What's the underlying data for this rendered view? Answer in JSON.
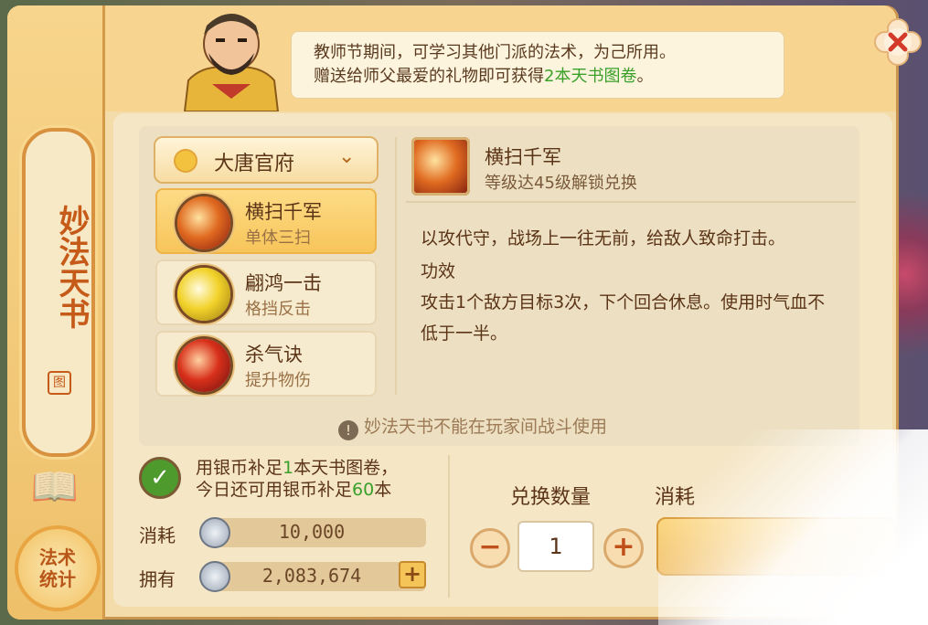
{
  "hint": {
    "line1": "教师节期间，可学习其他门派的法术，为己所用。",
    "line2_pre": "赠送给师父最爱的礼物即可获得",
    "line2_highlight": "2本天书图卷",
    "line2_post": "。"
  },
  "sidebar": {
    "title": "妙法天书",
    "seal": "图",
    "stats_button": "法术统计"
  },
  "sect_dropdown": {
    "selected": "大唐官府"
  },
  "skills": [
    {
      "name": "横扫千军",
      "desc": "单体三扫",
      "active": true
    },
    {
      "name": "翩鸿一击",
      "desc": "格挡反击",
      "active": false
    },
    {
      "name": "杀气诀",
      "desc": "提升物伤",
      "active": false
    }
  ],
  "detail": {
    "name": "横扫千军",
    "unlock": "等级达45级解锁兑换",
    "description": "以攻代守，战场上一往无前，给敌人致命打击。",
    "effect_title": "功效",
    "effect": "攻击1个敌方目标3次，下个回合休息。使用时气血不低于一半。"
  },
  "warning": "妙法天书不能在玩家间战斗使用",
  "supplement": {
    "line1_pre": "用银币补足",
    "line1_num": "1",
    "line1_post": "本天书图卷，",
    "line2_pre": "今日还可用银币补足",
    "line2_num": "60",
    "line2_post": "本"
  },
  "currency": {
    "cost_label": "消耗",
    "cost_value": "10,000",
    "own_label": "拥有",
    "own_value": "2,083,674",
    "plus_label": "+"
  },
  "exchange": {
    "qty_label": "兑换数量",
    "cost_label": "消耗",
    "qty_value": "1",
    "minus_label": "−",
    "plus_label": "+"
  },
  "colors": {
    "accent": "#f2c160",
    "highlight_green": "#3aa02a",
    "text": "#5b3417"
  }
}
